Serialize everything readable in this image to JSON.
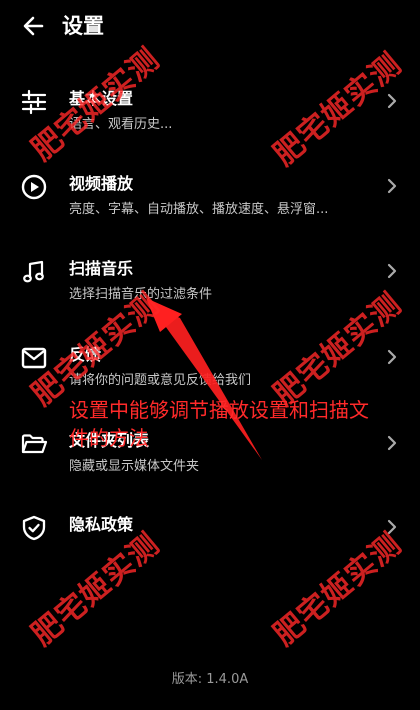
{
  "header": {
    "title": "设置",
    "back_icon": "arrow-left-icon"
  },
  "items": [
    {
      "icon": "sliders-icon",
      "title": "基本设置",
      "subtitle": "语言、观看历史..."
    },
    {
      "icon": "play-circle-icon",
      "title": "视频播放",
      "subtitle": "亮度、字幕、自动播放、播放速度、悬浮窗..."
    },
    {
      "icon": "music-note-icon",
      "title": "扫描音乐",
      "subtitle": "选择扫描音乐的过滤条件"
    },
    {
      "icon": "mail-icon",
      "title": "反馈",
      "subtitle": "请将你的问题或意见反馈给我们"
    },
    {
      "icon": "folder-icon",
      "title": "文件夹列表",
      "subtitle": "隐藏或显示媒体文件夹"
    },
    {
      "icon": "shield-check-icon",
      "title": "隐私政策"
    }
  ],
  "version": "版本: 1.4.0A",
  "annotation": {
    "text": "设置中能够调节播放设置和扫描文件的方法",
    "color": "#ff2a2a"
  },
  "watermark": {
    "text": "肥宅姬实测"
  }
}
